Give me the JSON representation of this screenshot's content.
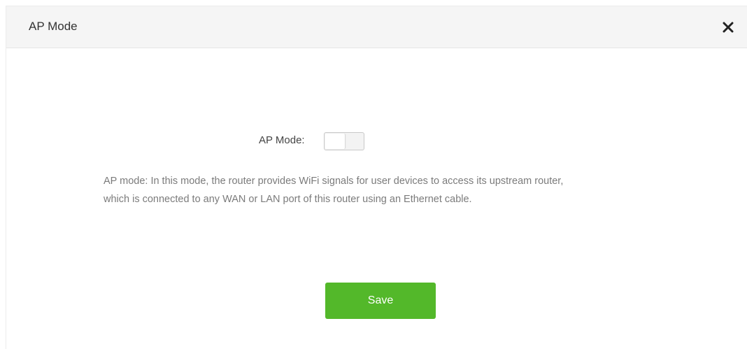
{
  "dialog": {
    "title": "AP Mode",
    "close_icon": "close-icon"
  },
  "ap_mode": {
    "label": "AP Mode:",
    "enabled": false,
    "description_line1": "AP mode: In this mode, the router provides WiFi signals for user devices to access its upstream router,",
    "description_line2": "which is connected to any WAN or LAN port of this router using an Ethernet cable."
  },
  "actions": {
    "save_label": "Save"
  },
  "colors": {
    "accent": "#53b82a",
    "header_bg": "#f5f5f5",
    "description_text": "#7b7b7b"
  }
}
